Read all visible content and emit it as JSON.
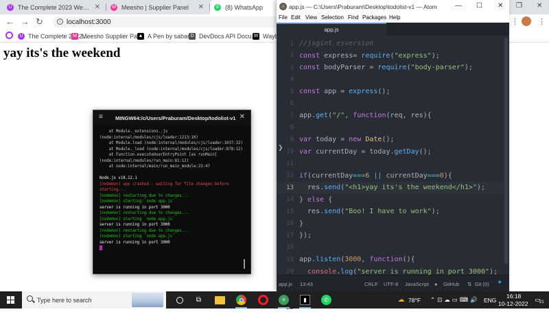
{
  "browser": {
    "tabs": [
      {
        "title": "The Complete 2023 Web Develop",
        "color": "#a435f0",
        "glyph": "U"
      },
      {
        "title": "Meesho | Supplier Panel",
        "color": "#f43397",
        "glyph": "M"
      },
      {
        "title": "(8) WhatsApp",
        "color": "#25d366",
        "glyph": "8"
      }
    ],
    "url": "localhost:3000",
    "bookmarks": [
      {
        "label": "The Complete 2022...",
        "color": "#a435f0",
        "glyph": "U"
      },
      {
        "label": "Meesho Supplier Pa...",
        "color": "#f43397",
        "glyph": "M"
      },
      {
        "label": "A Pen by sabari",
        "color": "#000000",
        "glyph": "▲"
      },
      {
        "label": "DevDocs API Docu...",
        "color": "#4c5158",
        "glyph": "D"
      },
      {
        "label": "Wayb",
        "color": "#000000",
        "glyph": "W"
      }
    ],
    "page_heading": "yay its's the weekend"
  },
  "terminal": {
    "title": "MINGW64:/c/Users/Praburam/Desktop/todolist-v1",
    "lines": [
      {
        "t": "    at Module._extensions..js (node:internal/modules/cjs/loader:1213:10)",
        "c": "gray"
      },
      {
        "t": "    at Module.load (node:internal/modules/cjs/loader:1037:32)",
        "c": "gray"
      },
      {
        "t": "    at Module._load (node:internal/modules/cjs/loader:878:12)",
        "c": "gray"
      },
      {
        "t": "    at Function.executeUserEntryPoint [as runMain] (node:internal/modules/run_main:81:12)",
        "c": "gray"
      },
      {
        "t": "    at node:internal/main/run_main_module:23:47",
        "c": "gray"
      },
      {
        "t": "",
        "c": "gap"
      },
      {
        "t": "Node.js v18.12.1",
        "c": "white"
      },
      {
        "t": "[nodemon] app crashed - waiting for file changes before starting...",
        "c": "red"
      },
      {
        "t": "[nodemon] restarting due to changes...",
        "c": "green"
      },
      {
        "t": "[nodemon] starting `node app.js`",
        "c": "green"
      },
      {
        "t": "server is running in port 3000",
        "c": "white"
      },
      {
        "t": "[nodemon] restarting due to changes...",
        "c": "green"
      },
      {
        "t": "[nodemon] starting `node app.js`",
        "c": "green"
      },
      {
        "t": "server is running in port 3000",
        "c": "white"
      },
      {
        "t": "[nodemon] restarting due to changes...",
        "c": "green"
      },
      {
        "t": "[nodemon] starting `node app.js`",
        "c": "green"
      },
      {
        "t": "server is running in port 3000",
        "c": "white"
      }
    ]
  },
  "atom": {
    "title": "app.js — C:\\Users\\Praburam\\Desktop\\todolist-v1 — Atom",
    "menu": [
      "File",
      "Edit",
      "View",
      "Selection",
      "Find",
      "Packages",
      "Help"
    ],
    "tab": "app.js",
    "active_line": 13,
    "code": [
      [
        [
          "cmt",
          "//jsgint esversion"
        ]
      ],
      [
        [
          "kw",
          "const "
        ],
        [
          "tx",
          "express= "
        ],
        [
          "fn",
          "require"
        ],
        [
          "tx",
          "("
        ],
        [
          "str",
          "\"express\""
        ],
        [
          "tx",
          ");"
        ]
      ],
      [
        [
          "kw",
          "const "
        ],
        [
          "tx",
          "bodyParser = "
        ],
        [
          "fn",
          "require"
        ],
        [
          "tx",
          "("
        ],
        [
          "str",
          "\"body-parser\""
        ],
        [
          "tx",
          ");"
        ]
      ],
      [],
      [
        [
          "kw",
          "const "
        ],
        [
          "tx",
          "app = "
        ],
        [
          "fn",
          "express"
        ],
        [
          "tx",
          "();"
        ]
      ],
      [],
      [
        [
          "tx",
          "app."
        ],
        [
          "fn",
          "get"
        ],
        [
          "tx",
          "("
        ],
        [
          "str",
          "\"/\""
        ],
        [
          "tx",
          ", "
        ],
        [
          "kw",
          "function"
        ],
        [
          "tx",
          "(req, res){"
        ]
      ],
      [],
      [
        [
          "kw",
          "var "
        ],
        [
          "tx",
          "today = "
        ],
        [
          "kw",
          "new "
        ],
        [
          "yl",
          "Date"
        ],
        [
          "tx",
          "();"
        ]
      ],
      [
        [
          "kw",
          "var "
        ],
        [
          "tx",
          "currentDay = today."
        ],
        [
          "fn",
          "getDay"
        ],
        [
          "tx",
          "();"
        ]
      ],
      [],
      [
        [
          "kw",
          "if"
        ],
        [
          "tx",
          "(currentDay"
        ],
        [
          "op",
          "==="
        ],
        [
          "num",
          "6"
        ],
        [
          "tx",
          " "
        ],
        [
          "op",
          "||"
        ],
        [
          "tx",
          " currentDay"
        ],
        [
          "op",
          "==="
        ],
        [
          "num",
          "0"
        ],
        [
          "tx",
          "){"
        ]
      ],
      [
        [
          "tx",
          "  res."
        ],
        [
          "fn",
          "send"
        ],
        [
          "tx",
          "("
        ],
        [
          "str",
          "\"<h1>yay its's the weekend</h1>\""
        ],
        [
          "tx",
          ");"
        ]
      ],
      [
        [
          "tx",
          "} "
        ],
        [
          "kw",
          "else"
        ],
        [
          "tx",
          " {"
        ]
      ],
      [
        [
          "tx",
          "  res."
        ],
        [
          "fn",
          "send"
        ],
        [
          "tx",
          "("
        ],
        [
          "str",
          "\"Boo! I have to work\""
        ],
        [
          "tx",
          ");"
        ]
      ],
      [
        [
          "tx",
          "}"
        ]
      ],
      [
        [
          "tx",
          "});"
        ]
      ],
      [],
      [
        [
          "tx",
          "app."
        ],
        [
          "fn",
          "listen"
        ],
        [
          "tx",
          "("
        ],
        [
          "num",
          "3000"
        ],
        [
          "tx",
          ", "
        ],
        [
          "kw",
          "function"
        ],
        [
          "tx",
          "(){"
        ]
      ],
      [
        [
          "tx",
          "  "
        ],
        [
          "vr",
          "console"
        ],
        [
          "tx",
          "."
        ],
        [
          "fn",
          "log"
        ],
        [
          "tx",
          "("
        ],
        [
          "str",
          "\"server is running in port 3000\""
        ],
        [
          "tx",
          ");"
        ]
      ],
      [],
      [
        [
          "tx",
          "});"
        ]
      ],
      []
    ],
    "status": {
      "file": "app.js",
      "position": "13:43",
      "line_ending": "CRLF",
      "encoding": "UTF-8",
      "grammar": "JavaScript",
      "github": "GitHub",
      "git": "Git (0)"
    }
  },
  "taskbar": {
    "search_placeholder": "Type here to search",
    "weather": "78°F",
    "language": "ENG",
    "time": "16:18",
    "date": "10-12-2022",
    "notifications": "21"
  }
}
